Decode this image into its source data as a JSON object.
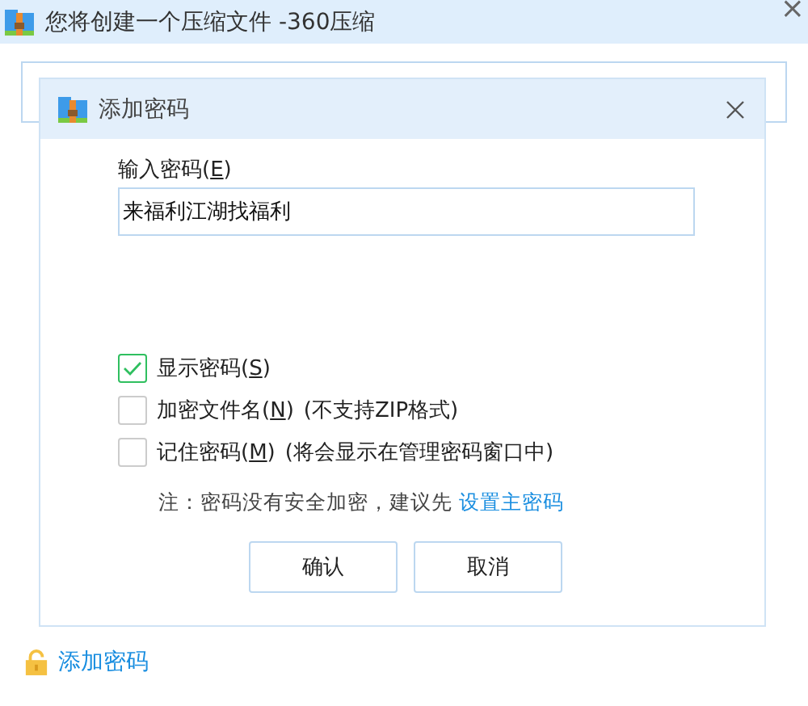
{
  "window": {
    "title": "您将创建一个压缩文件 -360压缩",
    "close_glyph": "×",
    "add_password_link": "添加密码"
  },
  "dialog": {
    "title": "添加密码",
    "password_label": {
      "before": "输入密码(",
      "key": "E",
      "after": ")"
    },
    "password_value": "来福利江湖找福利",
    "options": [
      {
        "before": "显示密码(",
        "key": "S",
        "after": ")",
        "checked": true
      },
      {
        "before": "加密文件名(",
        "key": "N",
        "after": ")",
        "note": "(不支持ZIP格式)",
        "checked": false
      },
      {
        "before": "记住密码(",
        "key": "M",
        "after": ")",
        "note": "(将会显示在管理密码窗口中)",
        "checked": false
      }
    ],
    "hint": "注：密码没有安全加密，建议先",
    "hint_link": "设置主密码",
    "buttons": [
      "确认",
      "取消"
    ]
  }
}
